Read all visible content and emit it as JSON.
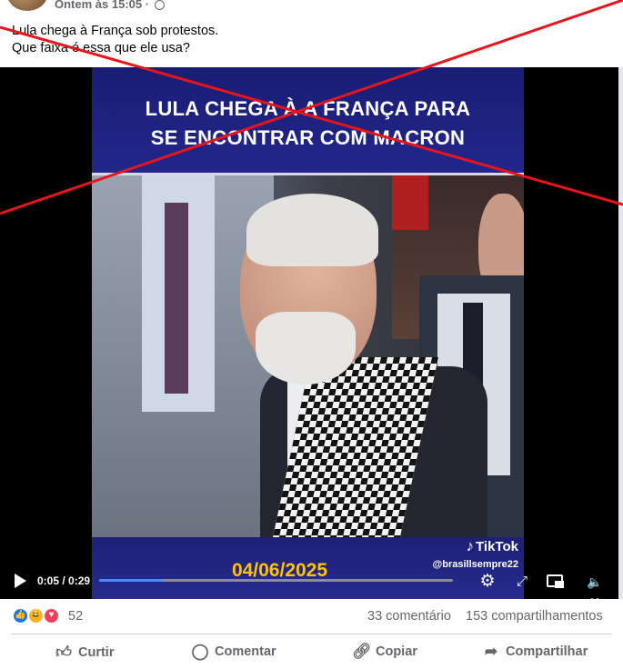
{
  "post": {
    "timestamp": "Ontem às 15:05 ·",
    "caption_line1": "Lula chega à França sob protestos.",
    "caption_line2": "Que faixa é essa que ele usa?"
  },
  "video": {
    "headline_line1": "LULA CHEGA À A FRANÇA PARA",
    "headline_line2": "SE ENCONTRAR COM MACRON",
    "date": "04/06/2025",
    "tiktok_brand": "TikTok",
    "tiktok_handle": "@brasillsempre22",
    "time_display": "0:05 / 0:29",
    "progress": 0.18
  },
  "stats": {
    "reaction_count": "52",
    "comments": "33 comentário",
    "shares": "153 compartilhamentos"
  },
  "actions": {
    "like": "Curtir",
    "comment": "Comentar",
    "copy": "Copiar",
    "share": "Compartilhar"
  },
  "overlay": {
    "x_color": "#e8141c"
  }
}
